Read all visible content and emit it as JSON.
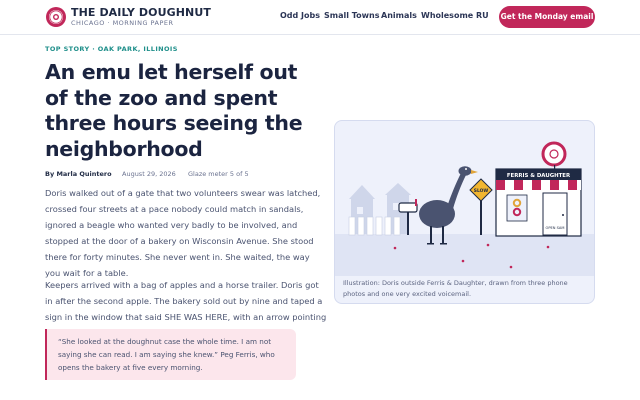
{
  "header": {
    "brand_name": "THE DAILY DOUGHNUT",
    "brand_tagline": "CHICAGO · MORNING PAPER",
    "nav": [
      "Odd Jobs",
      "Small Towns",
      "Animals",
      "Wholesome",
      "RU"
    ],
    "cta_label": "Get the Monday email"
  },
  "article": {
    "kicker": "TOP STORY · OAK PARK, ILLINOIS",
    "headline": "An emu let herself out of the zoo and spent three hours seeing the neighborhood",
    "byline": {
      "author": "By Marla Quintero",
      "date": "August 29, 2026",
      "meter": "Glaze meter 5 of 5"
    },
    "paragraphs": [
      "Doris walked out of a gate that two volunteers swear was latched, crossed four streets at a pace nobody could match in sandals, ignored a beagle who wanted very badly to be involved, and stopped at the door of a bakery on Wisconsin Avenue. She stood there for forty minutes. She never went in. She waited, the way you wait for a table.",
      "Keepers arrived with a bag of apples and a horse trailer. Doris got in after the second apple. The bakery sold out by nine and taped a sign in the window that said SHE WAS HERE, with an arrow pointing at the mat."
    ],
    "quote": {
      "text": "“She looked at the doughnut case the whole time. I am not saying she can read. I am saying she knew.”",
      "attribution": "Peg Ferris, who opens the bakery at five every morning."
    }
  },
  "illustration": {
    "shop_sign": "FERRIS & DAUGHTER",
    "road_sign": "SLOW",
    "door_sign": "OPEN SAM",
    "caption": "Illustration: Doris outside Ferris & Daughter, drawn from three phone photos and one very excited voicemail."
  },
  "colors": {
    "brand": "#c1275a",
    "ink": "#1f2a44",
    "accent_teal": "#1f8f8a",
    "quote_bg": "#fce6ec",
    "card_bg": "#eef1fb"
  }
}
